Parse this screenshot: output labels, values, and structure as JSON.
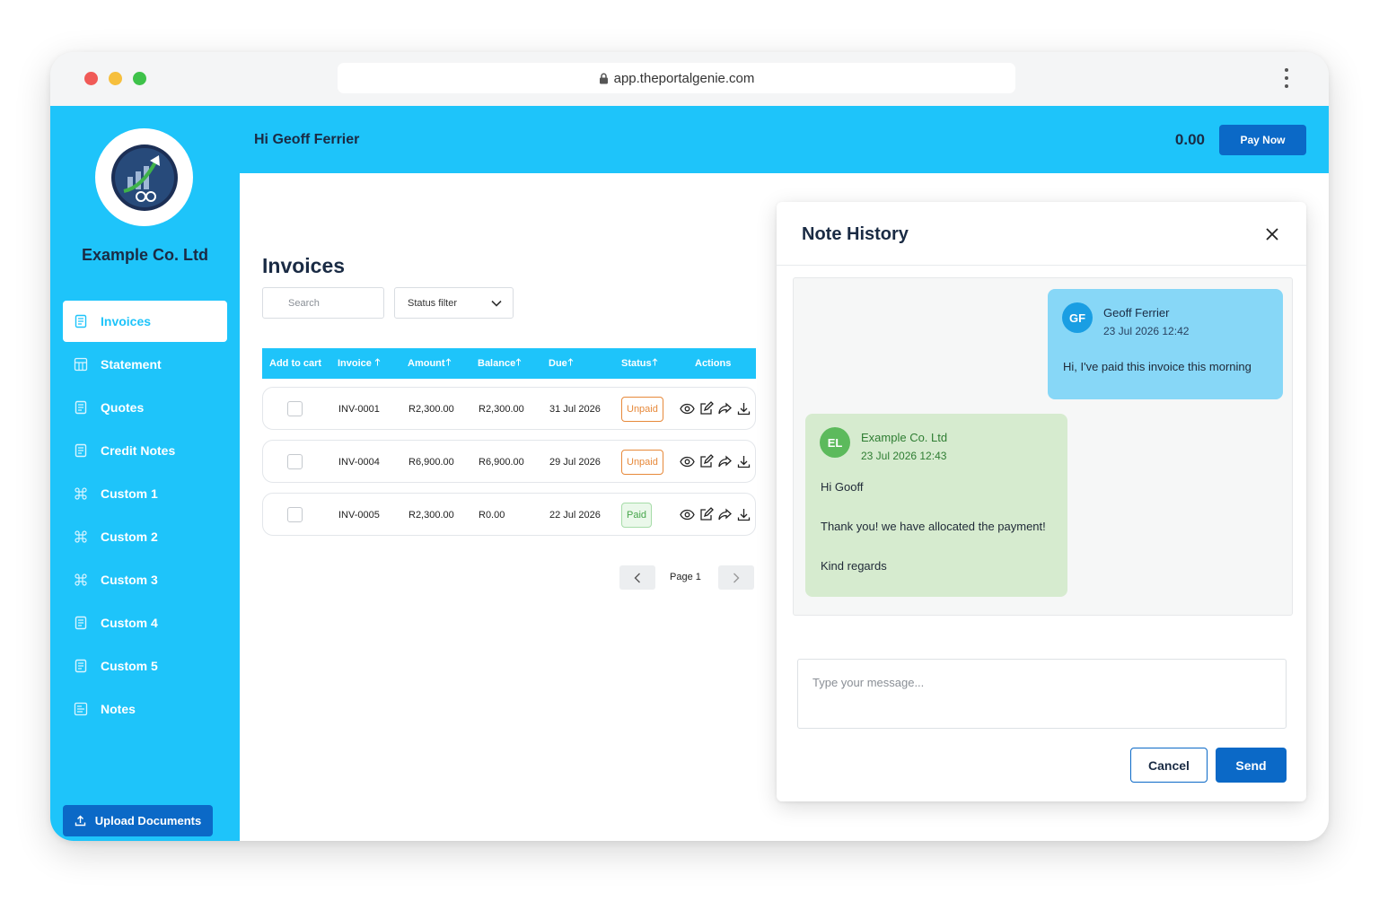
{
  "browser": {
    "url": "app.theportalgenie.com",
    "lock_icon": "lock-icon",
    "menu_icon": "kebab-menu-icon"
  },
  "sidebar": {
    "company_name": "Example Co. Ltd",
    "logo_icon": "growth-arrow-gears-logo",
    "items": [
      {
        "label": "Invoices",
        "icon": "document-icon",
        "active": true
      },
      {
        "label": "Statement",
        "icon": "statement-icon"
      },
      {
        "label": "Quotes",
        "icon": "document-icon"
      },
      {
        "label": "Credit Notes",
        "icon": "document-icon"
      },
      {
        "label": "Custom 1",
        "icon": "custom-icon"
      },
      {
        "label": "Custom 2",
        "icon": "custom-icon"
      },
      {
        "label": "Custom 3",
        "icon": "custom-icon"
      },
      {
        "label": "Custom 4",
        "icon": "document-icon"
      },
      {
        "label": "Custom 5",
        "icon": "document-icon"
      },
      {
        "label": "Notes",
        "icon": "notes-icon"
      }
    ],
    "upload_label": "Upload Documents",
    "upload_icon": "upload-icon"
  },
  "header": {
    "greeting": "Hi Geoff Ferrier",
    "balance": "0.00",
    "pay_now_label": "Pay Now"
  },
  "invoices": {
    "title": "Invoices",
    "search_placeholder": "Search",
    "status_filter_label": "Status filter",
    "columns": [
      "Add to cart",
      "Invoice",
      "Amount",
      "Balance",
      "Due",
      "Status",
      "Actions"
    ],
    "sort_icon": "arrow-up-icon",
    "rows": [
      {
        "invoice": "INV-0001",
        "amount": "R2,300.00",
        "balance": "R2,300.00",
        "due": "31 Jul 2026",
        "status": "Unpaid"
      },
      {
        "invoice": "INV-0004",
        "amount": "R6,900.00",
        "balance": "R6,900.00",
        "due": "29 Jul 2026",
        "status": "Unpaid"
      },
      {
        "invoice": "INV-0005",
        "amount": "R2,300.00",
        "balance": "R0.00",
        "due": "22 Jul 2026",
        "status": "Paid"
      }
    ],
    "action_icons": [
      "eye-icon",
      "edit-icon",
      "share-icon",
      "download-icon"
    ],
    "page_label": "Page 1",
    "status_colors": {
      "unpaid": "#e7893a",
      "paid": "#46a54a"
    }
  },
  "note_history": {
    "title": "Note History",
    "close_icon": "close-icon",
    "messages": [
      {
        "initials": "GF",
        "name": "Geoff Ferrier",
        "time": "23 Jul 2026 12:42",
        "lines": [
          "Hi, I've paid this invoice this morning"
        ]
      },
      {
        "initials": "EL",
        "name": "Example Co. Ltd",
        "time": "23 Jul 2026 12:43",
        "lines": [
          "Hi Gooff",
          "Thank you! we have allocated the payment!",
          "Kind regards"
        ]
      }
    ],
    "composer_placeholder": "Type your message...",
    "cancel_label": "Cancel",
    "send_label": "Send"
  },
  "colors": {
    "accent": "#1ec4fa",
    "primary_button": "#0b69c7",
    "heading": "#1a2b44"
  }
}
